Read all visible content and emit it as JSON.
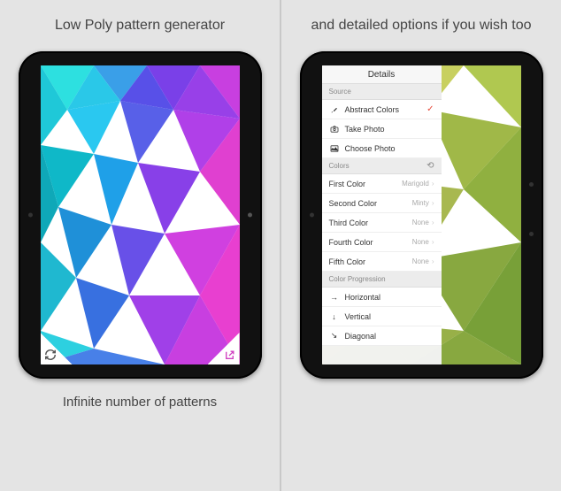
{
  "left": {
    "title": "Low Poly pattern generator",
    "footer": "Infinite number of patterns"
  },
  "right": {
    "title": "and detailed options if you wish too",
    "details_header": "Details",
    "sections": {
      "source": {
        "header": "Source",
        "items": [
          {
            "label": "Abstract Colors",
            "selected": true
          },
          {
            "label": "Take Photo"
          },
          {
            "label": "Choose Photo"
          }
        ]
      },
      "colors": {
        "header": "Colors",
        "items": [
          {
            "label": "First Color",
            "value": "Marigold"
          },
          {
            "label": "Second Color",
            "value": "Minty"
          },
          {
            "label": "Third Color",
            "value": "None"
          },
          {
            "label": "Fourth Color",
            "value": "None"
          },
          {
            "label": "Fifth Color",
            "value": "None"
          }
        ]
      },
      "progression": {
        "header": "Color Progression",
        "items": [
          {
            "label": "Horizontal"
          },
          {
            "label": "Vertical"
          },
          {
            "label": "Diagonal"
          }
        ]
      }
    }
  },
  "colors": {
    "cyan": "#2de0e0",
    "blue": "#3a6fe8",
    "magenta": "#d83fe0",
    "purple": "#a040f0",
    "yellow": "#d8d870",
    "olive": "#a0b050",
    "green": "#8fbf60"
  }
}
